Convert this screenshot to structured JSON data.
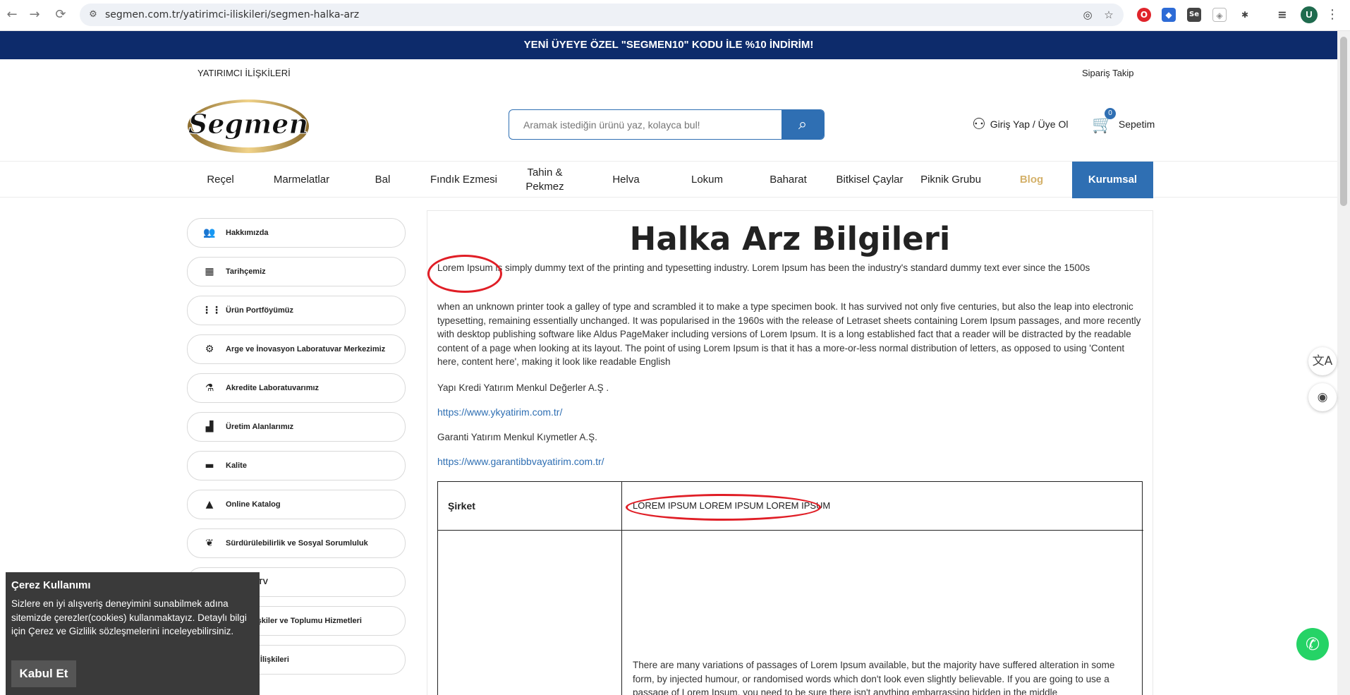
{
  "browser": {
    "back": "←",
    "forward": "→",
    "reload": "⟳",
    "site_info": "⚙",
    "url": "segmen.com.tr/yatirimci-iliskileri/segmen-halka-arz",
    "eye_off": "◎",
    "star": "☆",
    "ext_opera": "O",
    "ext_shield": "◆",
    "ext_se": "Se",
    "ext_guard": "◈",
    "ext_puzzle": "✱",
    "media": "≡",
    "profile_initial": "U",
    "menu": "⋮"
  },
  "promo": {
    "text": "YENİ ÜYEYE ÖZEL \"SEGMEN10\" KODU İLE %10 İNDİRİM!"
  },
  "header": {
    "investor_link": "YATIRIMCI İLİŞKİLERİ",
    "order_tracking": "Sipariş Takip",
    "logo_text": "Segmen",
    "search_placeholder": "Aramak istediğin ürünü yaz, kolayca bul!",
    "search_icon": "⌕",
    "account_icon": "⚇",
    "account_label": "Giriş Yap / Üye Ol",
    "cart_icon": "🛒",
    "cart_count": "0",
    "cart_label": "Sepetim"
  },
  "categories": [
    "Reçel",
    "Marmelatlar",
    "Bal",
    "Fındık Ezmesi",
    "Tahin & Pekmez",
    "Helva",
    "Lokum",
    "Baharat",
    "Bitkisel Çaylar",
    "Piknik Grubu",
    "Blog",
    "Kurumsal"
  ],
  "sidebar": [
    {
      "label": "Hakkımızda",
      "icon": "👥"
    },
    {
      "label": "Tarihçemiz",
      "icon": "▦"
    },
    {
      "label": "Ürün Portföyümüz",
      "icon": "⋮⋮"
    },
    {
      "label": "Arge ve İnovasyon Laboratuvar Merkezimiz",
      "icon": "⚙"
    },
    {
      "label": "Akredite Laboratuvarımız",
      "icon": "⚗"
    },
    {
      "label": "Üretim Alanlarımız",
      "icon": "▟"
    },
    {
      "label": "Kalite",
      "icon": "▬"
    },
    {
      "label": "Online Katalog",
      "icon": "▲"
    },
    {
      "label": "Sürdürülebilirlik ve Sosyal Sorumluluk",
      "icon": "❦"
    },
    {
      "label": "Segmen TV",
      "icon": "▭"
    },
    {
      "label": "Halkla İlişkiler ve Toplumu Hizmetleri",
      "icon": "◐"
    },
    {
      "label": "Yatırımcı İlişkileri",
      "icon": "▤"
    }
  ],
  "main": {
    "title": "Halka Arz Bilgileri",
    "para1": "Lorem Ipsum is simply dummy text of the printing and typesetting industry. Lorem Ipsum has been the industry's standard dummy text ever since the 1500s",
    "para2": "when an unknown printer took a galley of type and scrambled it to make a type specimen book. It has survived not only five centuries, but also the leap into electronic typesetting, remaining essentially unchanged. It was popularised in the 1960s with the release of Letraset sheets containing Lorem Ipsum passages, and more recently with desktop publishing software like Aldus PageMaker including versions of Lorem Ipsum. It is a long established fact that a reader will be distracted by the readable content of a page when looking at its layout. The point of using Lorem Ipsum is that it has a more-or-less normal distribution of letters, as opposed to using 'Content here, content here', making it look like readable English",
    "broker1": "Yapı Kredi Yatırım Menkul Değerler A.Ş .",
    "link1": "https://www.ykyatirim.com.tr/",
    "broker2": "Garanti Yatırım Menkul Kıymetler A.Ş.",
    "link2": "https://www.garantibbvayatirim.com.tr/",
    "table_header": "Şirket",
    "table_value": "LOREM IPSUM LOREM IPSUM LOREM IPSUM",
    "table_para": "There are many variations of passages of Lorem Ipsum available, but the majority have suffered alteration in some form, by injected humour, or randomised words which don't look even slightly believable. If you are going to use a passage of Lorem Ipsum, you need to be sure there isn't anything embarrassing hidden in the middle"
  },
  "cookie": {
    "title": "Çerez Kullanımı",
    "text": "Sizlere en iyi alışveriş deneyimini sunabilmek adına sitemizde çerezler(cookies) kullanmaktayız. Detaylı bilgi için Çerez ve Gizlilik sözleşmelerini inceleyebilirsiniz.",
    "accept": "Kabul Et"
  },
  "widgets": {
    "translate": "文A",
    "assistant": "◉",
    "whatsapp": "✆"
  },
  "colors": {
    "brand_blue": "#2f6fb3",
    "promo_navy": "#0d2b6b",
    "blog_gold": "#d4b16a",
    "annotation_red": "#e01e26"
  }
}
